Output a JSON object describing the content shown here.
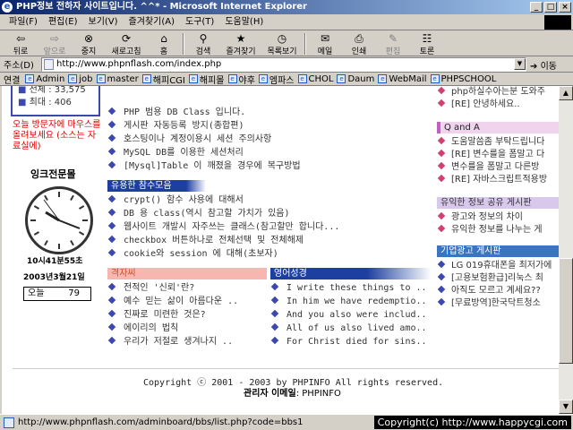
{
  "window": {
    "title": "PHP정보 전하자 사이트입니다. ^^* - Microsoft Internet Explorer",
    "min": "_",
    "max": "□",
    "close": "×"
  },
  "menu": [
    "파일(F)",
    "편집(E)",
    "보기(V)",
    "즐겨찾기(A)",
    "도구(T)",
    "도움말(H)"
  ],
  "toolbar": {
    "back": "뒤로",
    "forward": "앞으로",
    "stop": "중지",
    "refresh": "새로고침",
    "home": "홈",
    "search": "검색",
    "favorites": "즐겨찾기",
    "history": "목록보기",
    "mail": "메일",
    "print": "인쇄",
    "edit": "편집",
    "discuss": "토론"
  },
  "address": {
    "label": "주소(D)",
    "url": "http://www.phpnflash.com/index.php",
    "go": "이동"
  },
  "links": {
    "label": "연결",
    "items": [
      "Admin",
      "job",
      "master",
      "해피CGI",
      "해피몰",
      "야후",
      "엠파스",
      "CHOL",
      "Daum",
      "WebMail",
      "PHPSCHOOL"
    ]
  },
  "left": {
    "total_label": "전체 : 33,575",
    "max_label": "최대 : 406",
    "warning": "오늘 방문자에 마우스를 올려보세요 (소스는 자료실에)",
    "clock_title": "잉크전문몰",
    "clock_time": "10시41분55초",
    "clock_date": "2003년3월21일",
    "today_label": "오늘",
    "today_count": "79"
  },
  "mid": {
    "top_items": [
      "PHP 범용 DB Class 입니다.",
      "게시판 자동등록 방지(종합편)",
      "호스팅이나 계정이용시 세션 주의사항",
      "MySQL DB를 이용한 세션처리",
      "[Mysql]Table 이 깨졌을 경우에 복구방법"
    ],
    "section_useful": "유용한 참수모음",
    "useful_items": [
      "crypt() 함수 사용에 대해서",
      "DB 용 class(역시 참고할 가치가 있음)",
      "웹사이트 개발시 자주쓰는 클래스(참고할만 합니다...",
      "checkbox 버튼하나로 전체선택 및 전체해제",
      "cookie와 session 에 대해(초보자)"
    ],
    "section_daily": "격자씨",
    "daily_items": [
      "전적인 '신뢰'란?",
      "예수 믿는 삶이 아름다운 ..",
      "진짜로 미련한 것은?",
      "에이리의 법칙",
      "우리가 저절로 생겨나지 .."
    ],
    "section_english": "영어성경",
    "english_items": [
      "I write these things to ..",
      "In him we have redemptio..",
      "And you also were includ..",
      "All of us also lived amo..",
      "For Christ died for sins.."
    ]
  },
  "right": {
    "top_items": [
      "php하실수아는분 도와주",
      "[RE] 안녕하세요.."
    ],
    "section_qa": "Q and A",
    "qa_items": [
      "도움말씀좀 부탁드립니다",
      "[RE] 변수를을 폼말고 다",
      "변수를을 폼말고 다른방",
      "[RE] 자바스크립트적용방"
    ],
    "section_share": "유익한 정보 공유 게시판",
    "share_items": [
      "광고와 정보의 차이",
      "유익한 정보를 나누는 게"
    ],
    "section_ad": "기업광고 게시판",
    "ad_items": [
      "LG 019휴대폰을 최저가에",
      "[고용보험환급]리눅스 최",
      "아직도 모르고 계세요??",
      "[무료방역]한국닥트청소"
    ]
  },
  "footer": {
    "copyright": "Copyright ⓒ 2001 - 2003 by PHPINFO   All rights reserved.",
    "admin_label": "관리자 이메일",
    "admin_value": ": PHPINFO"
  },
  "status": {
    "url": "http://www.phpnflash.com/adminboard/bbs/list.php?code=bbs1",
    "copyright": "Copyright(c) http://www.happycgi.com"
  }
}
